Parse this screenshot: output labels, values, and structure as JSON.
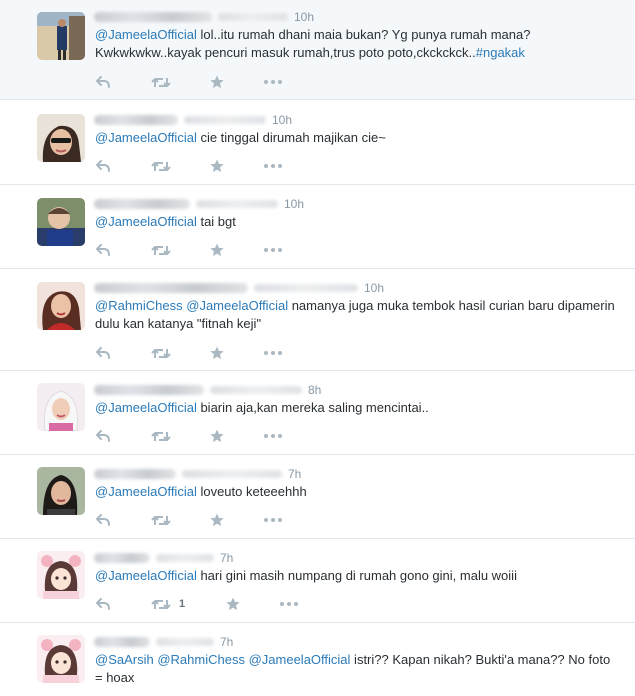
{
  "tweets": [
    {
      "time": "10h",
      "segments": [
        {
          "t": "@JameelaOfficial",
          "k": "mention"
        },
        {
          "t": " lol..itu rumah dhani maia bukan? Yg punya rumah mana? Kwkwkwkw..kayak pencuri masuk rumah,trus poto poto,ckckckck..",
          "k": "text"
        },
        {
          "t": "#ngakak",
          "k": "hashtag"
        }
      ]
    },
    {
      "time": "10h",
      "segments": [
        {
          "t": "@JameelaOfficial",
          "k": "mention"
        },
        {
          "t": " cie tinggal dirumah majikan cie~",
          "k": "text"
        }
      ]
    },
    {
      "time": "10h",
      "segments": [
        {
          "t": "@JameelaOfficial",
          "k": "mention"
        },
        {
          "t": " tai bgt",
          "k": "text"
        }
      ]
    },
    {
      "time": "10h",
      "segments": [
        {
          "t": "@RahmiChess",
          "k": "mention"
        },
        {
          "t": " ",
          "k": "text"
        },
        {
          "t": "@JameelaOfficial",
          "k": "mention"
        },
        {
          "t": " namanya juga muka tembok hasil curian baru dipamerin dulu kan katanya \"fitnah keji\"",
          "k": "text"
        }
      ]
    },
    {
      "time": "8h",
      "segments": [
        {
          "t": "@JameelaOfficial",
          "k": "mention"
        },
        {
          "t": " biarin aja,kan mereka saling mencintai..",
          "k": "text"
        }
      ]
    },
    {
      "time": "7h",
      "segments": [
        {
          "t": "@JameelaOfficial",
          "k": "mention"
        },
        {
          "t": " loveuto keteeehhh",
          "k": "text"
        }
      ]
    },
    {
      "time": "7h",
      "retweet_count": "1",
      "segments": [
        {
          "t": "@JameelaOfficial",
          "k": "mention"
        },
        {
          "t": " hari gini masih numpang di rumah gono gini, malu woiii",
          "k": "text"
        }
      ]
    },
    {
      "time": "7h",
      "segments": [
        {
          "t": "@SaArsih",
          "k": "mention"
        },
        {
          "t": " ",
          "k": "text"
        },
        {
          "t": "@RahmiChess",
          "k": "mention"
        },
        {
          "t": " ",
          "k": "text"
        },
        {
          "t": "@JameelaOfficial",
          "k": "mention"
        },
        {
          "t": " istri?? Kapan nikah? Bukti'a mana?? No foto = hoax",
          "k": "text"
        }
      ]
    }
  ],
  "icons": {
    "reply": "reply-icon",
    "retweet": "retweet-icon",
    "favorite": "star-icon",
    "more": "more-icon"
  },
  "colors": {
    "link": "#2b7bb9",
    "text": "#292f33",
    "meta": "#8899a6",
    "icon": "#aab8c2",
    "divider": "#e1e8ed"
  }
}
